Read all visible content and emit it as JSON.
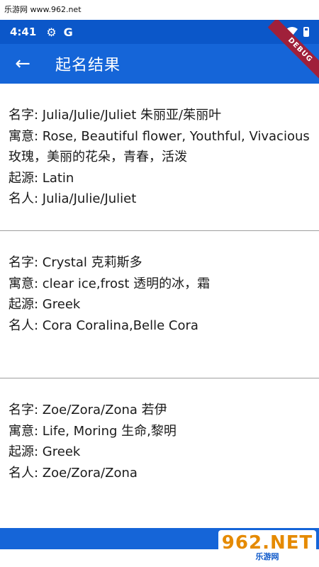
{
  "watermark": {
    "site": "乐游网 www.962.net"
  },
  "status_bar": {
    "time": "4:41",
    "settings_icon": "gear-icon",
    "google_icon": "G"
  },
  "app_bar": {
    "title": "起名结果",
    "back_icon": "←"
  },
  "debug_ribbon": "DEBUG",
  "entries": [
    {
      "name": "名字: Julia/Julie/Juliet  朱丽亚/茱丽叶",
      "meaning_en": "寓意: Rose, Beautiful flower, Youthful, Vivacious",
      "meaning_zh": "玫瑰，美丽的花朵，青春，活泼",
      "origin": "起源:  Latin",
      "famous": "名人: Julia/Julie/Juliet"
    },
    {
      "name": "名字: Crystal  克莉斯多",
      "meaning": "寓意: clear ice,frost  透明的冰，霜",
      "origin": "起源:  Greek",
      "famous": "名人: Cora Coralina,Belle Cora"
    },
    {
      "name": "名字: Zoe/Zora/Zona  若伊",
      "meaning": "寓意: Life, Moring  生命,黎明",
      "origin": "起源:  Greek",
      "famous": "名人: Zoe/Zora/Zona"
    }
  ],
  "logo": {
    "main": "962.NET",
    "sub": "乐游网"
  },
  "colors": {
    "status_bar": "#0b57c9",
    "app_bar": "#1565d8",
    "ribbon": "#a0203a"
  }
}
